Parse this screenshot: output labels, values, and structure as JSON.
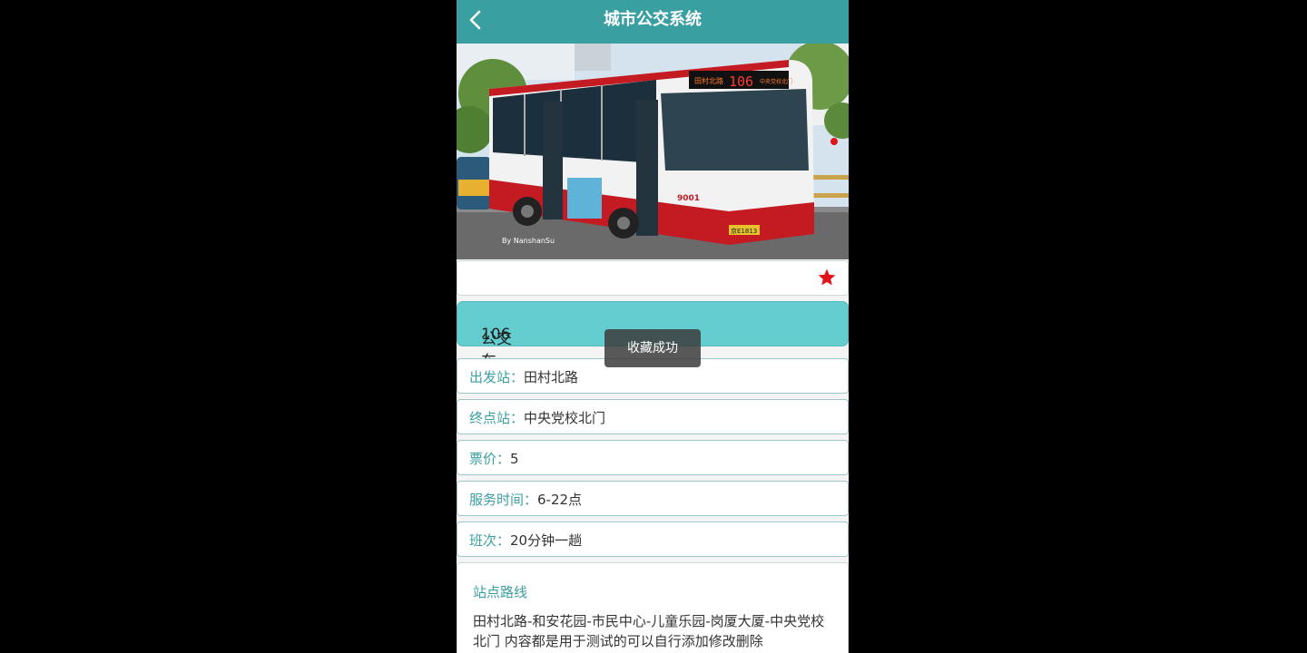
{
  "header": {
    "title": "城市公交系统",
    "back_icon": "chevron-left-icon"
  },
  "banner": {
    "sign_left": "田村北路",
    "sign_number": "106",
    "sign_right": "中央党校北门",
    "bus_number": "9001",
    "plate": "京E1813",
    "watermark": "By NanshanSu"
  },
  "favorite": {
    "icon": "star-icon",
    "color": "#e0121a"
  },
  "bus": {
    "label": "公交车号：",
    "number": "106"
  },
  "details": [
    {
      "label": "出发站：",
      "value": "田村北路"
    },
    {
      "label": "终点站：",
      "value": "中央党校北门"
    },
    {
      "label": "票价：",
      "value": "5"
    },
    {
      "label": "服务时间：",
      "value": "6-22点"
    },
    {
      "label": "班次：",
      "value": "20分钟一趟"
    }
  ],
  "route": {
    "title": "站点路线",
    "text": "田村北路-和安花园-市民中心-儿童乐园-岗厦大厦-中央党校北门 内容都是用于测试的可以自行添加修改删除"
  },
  "toast": {
    "text": "收藏成功"
  },
  "colors": {
    "primary": "#3a9fa0",
    "bus_card": "#63cdd0",
    "star": "#e0121a"
  }
}
